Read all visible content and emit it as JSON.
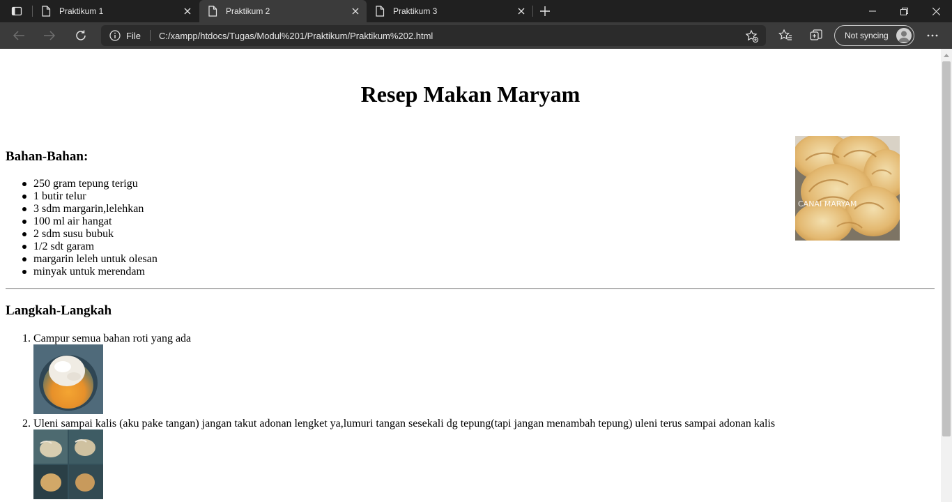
{
  "browser": {
    "tabs": [
      {
        "title": "Praktikum 1",
        "active": false
      },
      {
        "title": "Praktikum 2",
        "active": true
      },
      {
        "title": "Praktikum 3",
        "active": false
      }
    ],
    "address": {
      "scheme_label": "File",
      "url": "C:/xampp/htdocs/Tugas/Modul%201/Praktikum/Praktikum%202.html"
    },
    "profile": {
      "sync_label": "Not syncing"
    },
    "colors": {
      "frame": "#202020",
      "toolbar": "#3b3b3b",
      "address_bg": "#2b2b2b",
      "text": "#e6e6e6"
    }
  },
  "page": {
    "title": "Resep Makan Maryam",
    "ingredients": {
      "heading": "Bahan-Bahan:",
      "items": [
        "250 gram tepung terigu",
        "1 butir telur",
        "3 sdm margarin,lelehkan",
        "100 ml air hangat",
        "2 sdm susu bubuk",
        "1/2 sdt garam",
        "margarin leleh untuk olesan",
        "minyak untuk merendam"
      ]
    },
    "main_image_watermark": "CANAI MARYAM",
    "steps": {
      "heading": "Langkah-Langkah",
      "items": [
        {
          "number": "1.",
          "text": "Campur semua bahan roti yang ada"
        },
        {
          "number": "2.",
          "text": "Uleni sampai kalis (aku pake tangan) jangan takut adonan lengket ya,lumuri tangan sesekali dg tepung(tapi jangan menambah tepung) uleni terus sampai adonan kalis"
        }
      ]
    }
  }
}
